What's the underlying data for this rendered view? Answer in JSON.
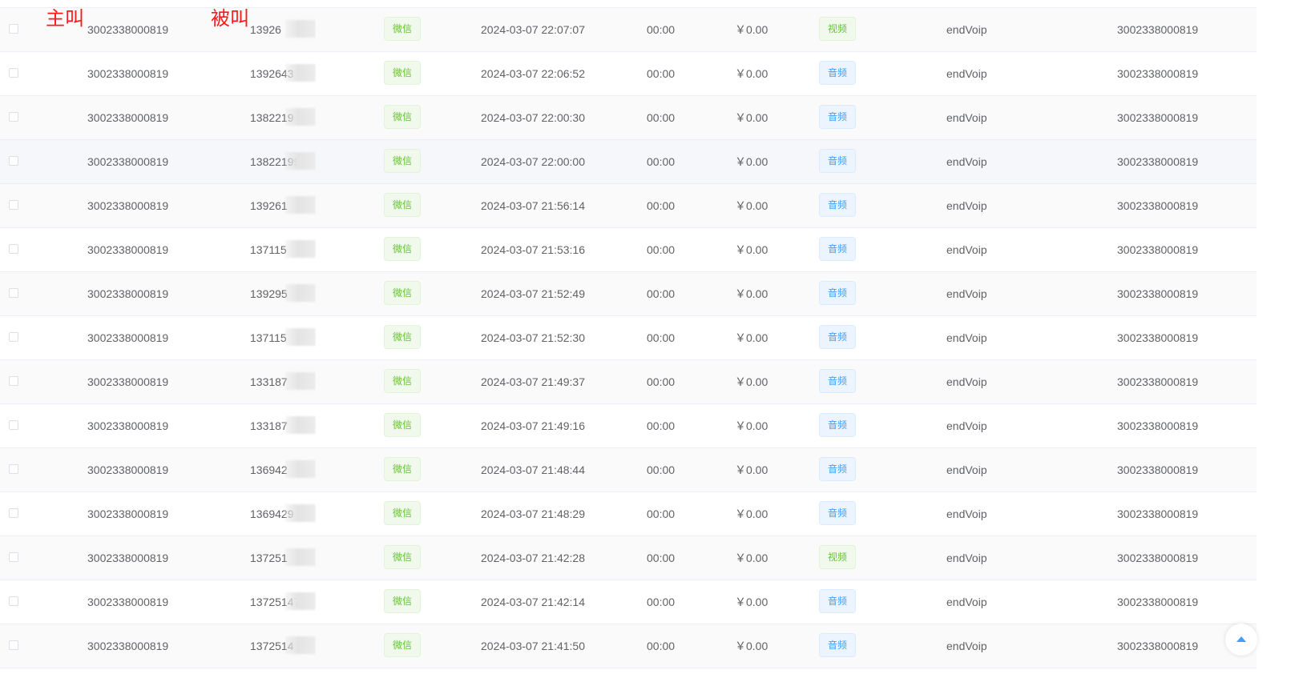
{
  "annotations": {
    "caller": "主叫",
    "callee": "被叫"
  },
  "rows": [
    {
      "caller": "3002338000819",
      "callee": "13926",
      "channel": "微信",
      "time": "2024-03-07 22:07:07",
      "duration": "00:00",
      "cost": "￥0.00",
      "type": "视频",
      "type_kind": "video",
      "end": "endVoip",
      "account": "3002338000819"
    },
    {
      "caller": "3002338000819",
      "callee": "1392643",
      "channel": "微信",
      "time": "2024-03-07 22:06:52",
      "duration": "00:00",
      "cost": "￥0.00",
      "type": "音频",
      "type_kind": "audio",
      "end": "endVoip",
      "account": "3002338000819"
    },
    {
      "caller": "3002338000819",
      "callee": "1382219",
      "channel": "微信",
      "time": "2024-03-07 22:00:30",
      "duration": "00:00",
      "cost": "￥0.00",
      "type": "音频",
      "type_kind": "audio",
      "end": "endVoip",
      "account": "3002338000819"
    },
    {
      "caller": "3002338000819",
      "callee": "13822199",
      "channel": "微信",
      "time": "2024-03-07 22:00:00",
      "duration": "00:00",
      "cost": "￥0.00",
      "type": "音频",
      "type_kind": "audio",
      "end": "endVoip",
      "account": "3002338000819"
    },
    {
      "caller": "3002338000819",
      "callee": "139261",
      "channel": "微信",
      "time": "2024-03-07 21:56:14",
      "duration": "00:00",
      "cost": "￥0.00",
      "type": "音频",
      "type_kind": "audio",
      "end": "endVoip",
      "account": "3002338000819"
    },
    {
      "caller": "3002338000819",
      "callee": "137115",
      "channel": "微信",
      "time": "2024-03-07 21:53:16",
      "duration": "00:00",
      "cost": "￥0.00",
      "type": "音频",
      "type_kind": "audio",
      "end": "endVoip",
      "account": "3002338000819"
    },
    {
      "caller": "3002338000819",
      "callee": "139295",
      "channel": "微信",
      "time": "2024-03-07 21:52:49",
      "duration": "00:00",
      "cost": "￥0.00",
      "type": "音频",
      "type_kind": "audio",
      "end": "endVoip",
      "account": "3002338000819"
    },
    {
      "caller": "3002338000819",
      "callee": "137115",
      "channel": "微信",
      "time": "2024-03-07 21:52:30",
      "duration": "00:00",
      "cost": "￥0.00",
      "type": "音频",
      "type_kind": "audio",
      "end": "endVoip",
      "account": "3002338000819"
    },
    {
      "caller": "3002338000819",
      "callee": "133187",
      "channel": "微信",
      "time": "2024-03-07 21:49:37",
      "duration": "00:00",
      "cost": "￥0.00",
      "type": "音频",
      "type_kind": "audio",
      "end": "endVoip",
      "account": "3002338000819"
    },
    {
      "caller": "3002338000819",
      "callee": "133187",
      "channel": "微信",
      "time": "2024-03-07 21:49:16",
      "duration": "00:00",
      "cost": "￥0.00",
      "type": "音频",
      "type_kind": "audio",
      "end": "endVoip",
      "account": "3002338000819"
    },
    {
      "caller": "3002338000819",
      "callee": "136942",
      "channel": "微信",
      "time": "2024-03-07 21:48:44",
      "duration": "00:00",
      "cost": "￥0.00",
      "type": "音频",
      "type_kind": "audio",
      "end": "endVoip",
      "account": "3002338000819"
    },
    {
      "caller": "3002338000819",
      "callee": "1369429",
      "channel": "微信",
      "time": "2024-03-07 21:48:29",
      "duration": "00:00",
      "cost": "￥0.00",
      "type": "音频",
      "type_kind": "audio",
      "end": "endVoip",
      "account": "3002338000819"
    },
    {
      "caller": "3002338000819",
      "callee": "137251",
      "channel": "微信",
      "time": "2024-03-07 21:42:28",
      "duration": "00:00",
      "cost": "￥0.00",
      "type": "视频",
      "type_kind": "video",
      "end": "endVoip",
      "account": "3002338000819"
    },
    {
      "caller": "3002338000819",
      "callee": "13725147",
      "channel": "微信",
      "time": "2024-03-07 21:42:14",
      "duration": "00:00",
      "cost": "￥0.00",
      "type": "音频",
      "type_kind": "audio",
      "end": "endVoip",
      "account": "3002338000819"
    },
    {
      "caller": "3002338000819",
      "callee": "1372514",
      "channel": "微信",
      "time": "2024-03-07 21:41:50",
      "duration": "00:00",
      "cost": "￥0.00",
      "type": "音频",
      "type_kind": "audio",
      "end": "endVoip",
      "account": "3002338000819"
    }
  ],
  "row_backgrounds": [
    "gray",
    "white",
    "gray",
    "light",
    "gray",
    "white",
    "gray",
    "white",
    "gray",
    "white",
    "gray",
    "white",
    "gray",
    "white",
    "gray"
  ],
  "colors": {
    "annotation": "#ff1a1a",
    "channel_tag": "#67c23a",
    "audio_tag": "#409eff",
    "video_tag": "#67c23a"
  },
  "icons": {
    "back_to_top": "caret-up-icon",
    "redaction": "pixel-mask"
  }
}
